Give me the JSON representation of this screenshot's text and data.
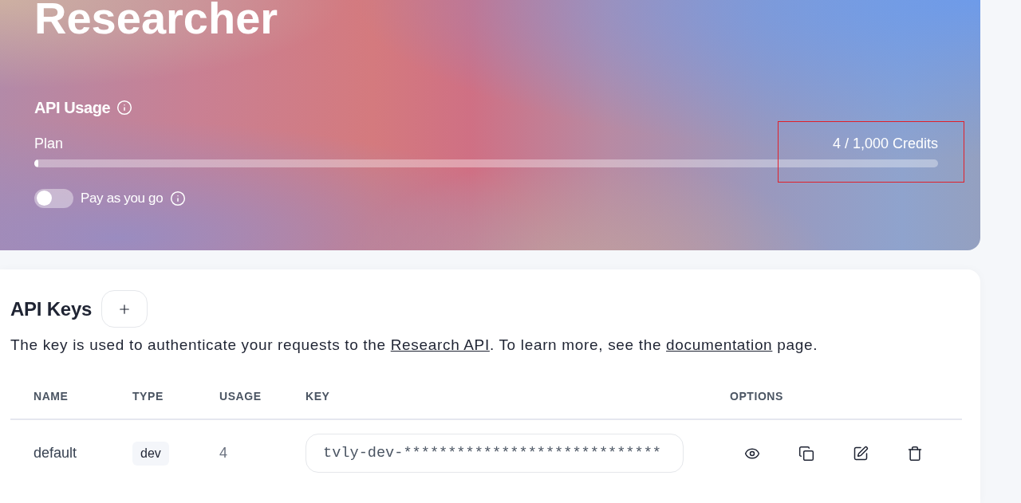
{
  "hero": {
    "title": "Researcher"
  },
  "usage": {
    "heading": "API Usage",
    "plan_label": "Plan",
    "credits": "4 / 1,000 Credits",
    "level": 0.004,
    "highlighted": true
  },
  "pay_as_you_go": {
    "label": "Pay as you go",
    "on": false
  },
  "api_keys": {
    "heading": "API Keys",
    "description": [
      {
        "kind": "text",
        "text": "The key is used to authenticate your requests to the "
      },
      {
        "kind": "link",
        "text": "Research API"
      },
      {
        "kind": "text",
        "text": ". To learn more, see the "
      },
      {
        "kind": "link",
        "text": "documentation"
      },
      {
        "kind": "text",
        "text": " page."
      }
    ],
    "columns": [
      "NAME",
      "TYPE",
      "USAGE",
      "KEY",
      "OPTIONS"
    ],
    "rows": [
      {
        "name": "default",
        "type": "dev",
        "usage": "4",
        "key": "tvly-dev-*****************************"
      }
    ]
  }
}
